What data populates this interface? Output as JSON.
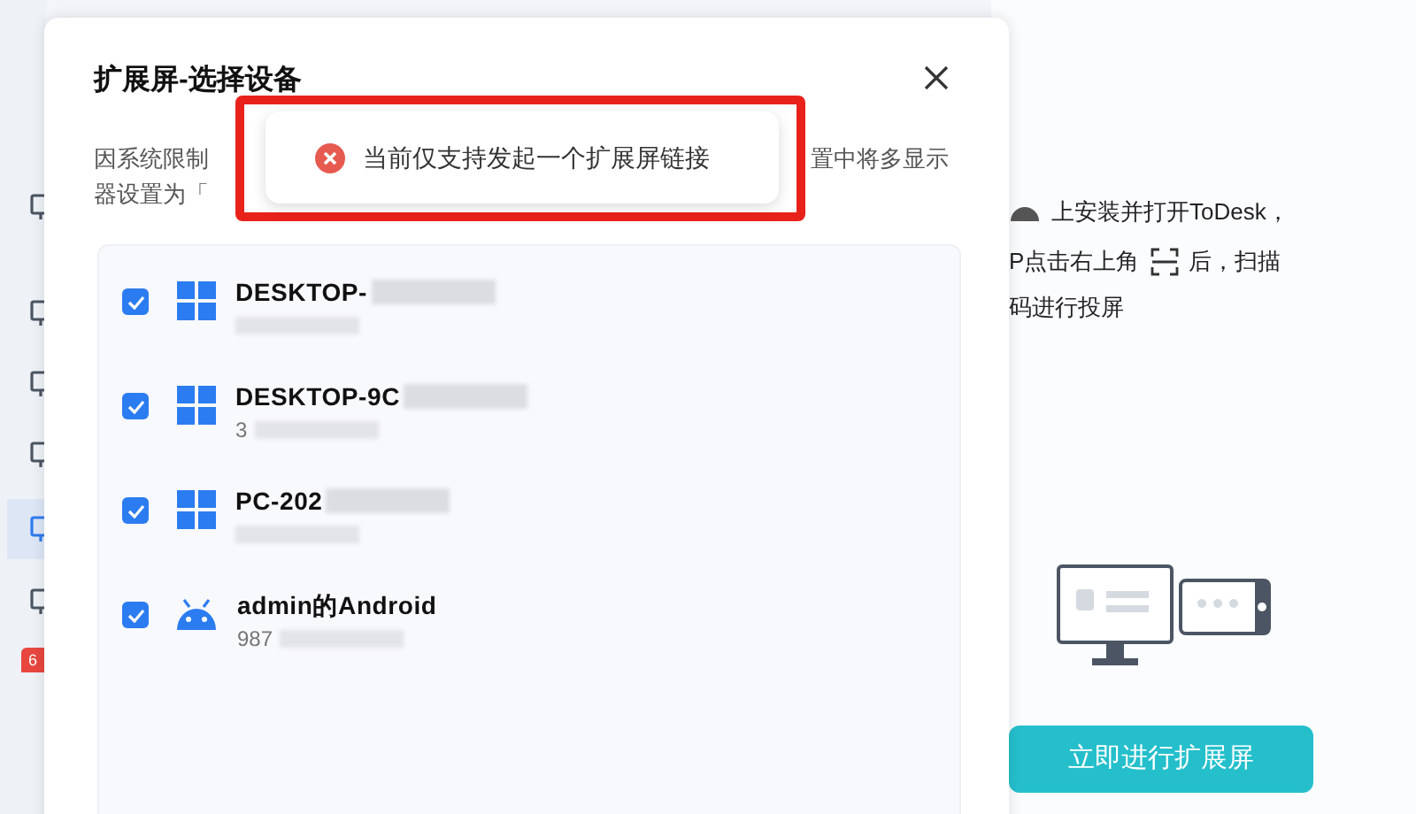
{
  "sidebar": {
    "items": [
      {
        "selected": false
      },
      {
        "selected": false
      },
      {
        "selected": false
      },
      {
        "selected": false
      },
      {
        "selected": true
      },
      {
        "selected": false
      }
    ],
    "badge": "6"
  },
  "guide": {
    "line_1": "上安装并打开ToDesk，",
    "line_2a": "P点击右上角",
    "line_2b": "后，扫描",
    "line_3": "码进行投屏",
    "button": "立即进行扩展屏"
  },
  "dialog": {
    "title": "扩展屏-选择设备",
    "description": {
      "line_1_start": "因系统限制",
      "line_1_end": "置中将多显示",
      "line_2_start": "器设置为「"
    },
    "devices": [
      {
        "kind": "windows",
        "name": "DESKTOP-",
        "checked": true
      },
      {
        "kind": "windows",
        "name": "DESKTOP-9C",
        "detail": "3",
        "checked": true
      },
      {
        "kind": "windows",
        "name": "PC-202",
        "checked": true
      },
      {
        "kind": "android",
        "name": "admin的Android",
        "detail": "987",
        "checked": true
      }
    ]
  },
  "toast": {
    "message": "当前仅支持发起一个扩展屏链接",
    "highlighted": true
  }
}
